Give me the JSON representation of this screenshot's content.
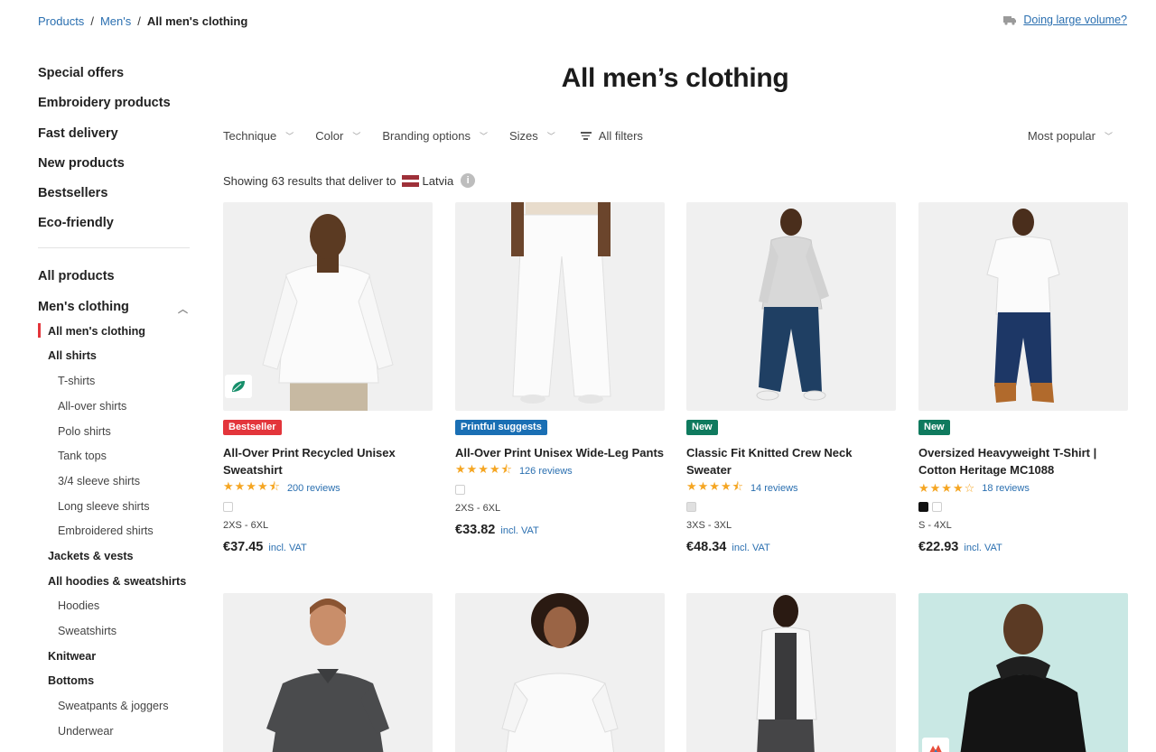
{
  "breadcrumb": {
    "items": [
      "Products",
      "Men's"
    ],
    "current": "All men's clothing"
  },
  "volume_link": "Doing large volume?",
  "page_title": "All men’s clothing",
  "sidebar": {
    "top_items": [
      "Special offers",
      "Embroidery products",
      "Fast delivery",
      "New products",
      "Bestsellers",
      "Eco-friendly"
    ],
    "all_products": "All products",
    "mens_clothing": "Men's clothing",
    "subitems": [
      {
        "label": "All men's clothing",
        "level": 1,
        "active": true
      },
      {
        "label": "All shirts",
        "level": 1
      },
      {
        "label": "T-shirts",
        "level": 2
      },
      {
        "label": "All-over shirts",
        "level": 2
      },
      {
        "label": "Polo shirts",
        "level": 2
      },
      {
        "label": "Tank tops",
        "level": 2
      },
      {
        "label": "3/4 sleeve shirts",
        "level": 2
      },
      {
        "label": "Long sleeve shirts",
        "level": 2
      },
      {
        "label": "Embroidered shirts",
        "level": 2
      },
      {
        "label": "Jackets & vests",
        "level": 1
      },
      {
        "label": "All hoodies & sweatshirts",
        "level": 1
      },
      {
        "label": "Hoodies",
        "level": 2
      },
      {
        "label": "Sweatshirts",
        "level": 2
      },
      {
        "label": "Knitwear",
        "level": 1
      },
      {
        "label": "Bottoms",
        "level": 1
      },
      {
        "label": "Sweatpants & joggers",
        "level": 2
      },
      {
        "label": "Underwear",
        "level": 2
      }
    ]
  },
  "filters": {
    "technique": "Technique",
    "color": "Color",
    "branding": "Branding options",
    "sizes": "Sizes",
    "all": "All filters",
    "sort": "Most popular"
  },
  "results": {
    "text": "Showing 63 results that deliver to",
    "country": "Latvia",
    "info": "i"
  },
  "products": [
    {
      "badge": "Bestseller",
      "name": "All-Over Print Recycled Unisex Sweatshirt",
      "stars": "★★★★⯪",
      "reviews": "200 reviews",
      "sizes": "2XS - 6XL",
      "price": "€37.45",
      "vat": "incl. VAT"
    },
    {
      "badge": "Printful suggests",
      "name": "All-Over Print Unisex Wide-Leg Pants",
      "stars": "★★★★⯪",
      "reviews": "126 reviews",
      "sizes": "2XS - 6XL",
      "price": "€33.82",
      "vat": "incl. VAT"
    },
    {
      "badge": "New",
      "name": "Classic Fit Knitted Crew Neck Sweater",
      "stars": "★★★★⯪",
      "reviews": "14 reviews",
      "sizes": "3XS - 3XL",
      "price": "€48.34",
      "vat": "incl. VAT"
    },
    {
      "badge": "New",
      "name": "Oversized Heavyweight T-Shirt | Cotton Heritage MC1088",
      "stars": "★★★★☆",
      "reviews": "18 reviews",
      "sizes": "S - 4XL",
      "price": "€22.93",
      "vat": "incl. VAT"
    }
  ],
  "colors": {
    "link": "#2a6fb0",
    "badge_red": "#e3353b",
    "badge_blue": "#1a6fb4",
    "badge_green": "#0f7a5e",
    "star": "#f5a623"
  }
}
